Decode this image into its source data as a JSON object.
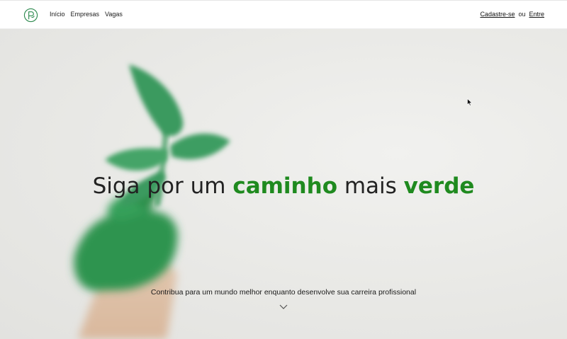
{
  "nav": {
    "links": [
      {
        "label": "Início"
      },
      {
        "label": "Empresas"
      },
      {
        "label": "Vagas"
      }
    ],
    "signup_label": "Cadastre-se",
    "separator": "ou",
    "login_label": "Entre"
  },
  "hero": {
    "headline_part1": "Siga por um ",
    "headline_accent1": "caminho",
    "headline_part2": " mais ",
    "headline_accent2": "verde",
    "subtitle": "Contribua para um mundo melhor enquanto desenvolve sua carreira profissional"
  },
  "colors": {
    "accent_green": "#1f8a1f",
    "background": "#ecebe8"
  },
  "icons": {
    "logo": "brand-logo-icon",
    "scroll": "chevron-down-icon",
    "cursor": "mouse-cursor-icon"
  }
}
